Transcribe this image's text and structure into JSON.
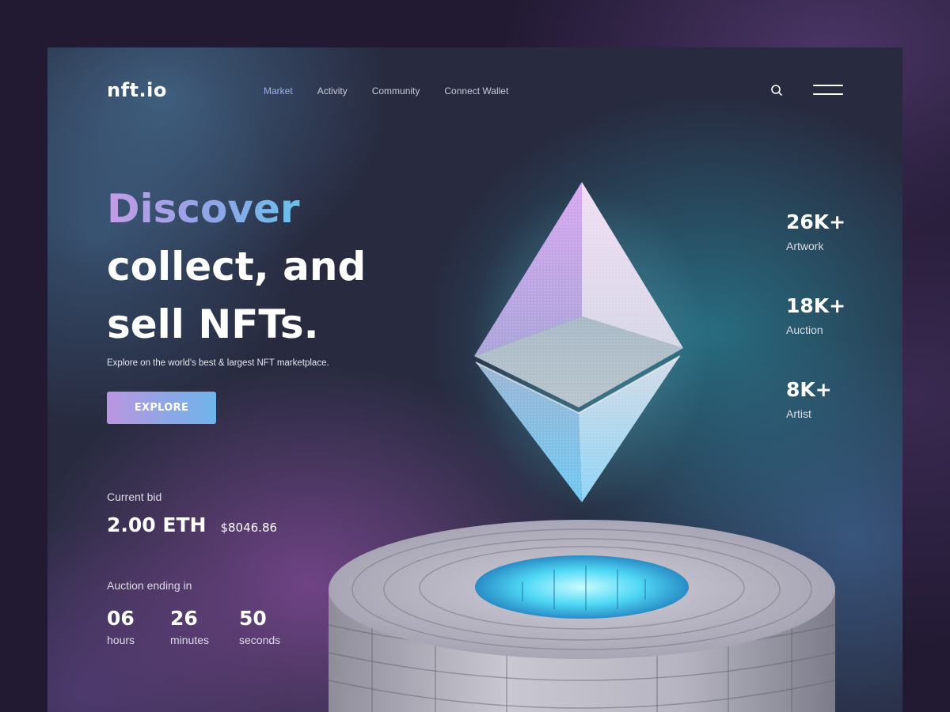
{
  "header": {
    "logo": "nft.io",
    "nav": [
      {
        "label": "Market",
        "active": true
      },
      {
        "label": "Activity",
        "active": false
      },
      {
        "label": "Community",
        "active": false
      },
      {
        "label": "Connect Wallet",
        "active": false
      }
    ],
    "icons": [
      "search-icon",
      "menu-icon"
    ]
  },
  "hero": {
    "title_highlight": "Discover",
    "title_line2": "collect, and",
    "title_line3": "sell NFTs.",
    "subtitle": "Explore on the world's best & largest NFT marketplace.",
    "cta_label": "EXPLORE"
  },
  "bid": {
    "label": "Current bid",
    "eth": "2.00 ETH",
    "usd": "$8046.86"
  },
  "auction": {
    "label": "Auction ending in",
    "countdown": [
      {
        "value": "06",
        "unit": "hours"
      },
      {
        "value": "26",
        "unit": "minutes"
      },
      {
        "value": "50",
        "unit": "seconds"
      }
    ]
  },
  "stats": [
    {
      "value": "26K+",
      "label": "Artwork"
    },
    {
      "value": "18K+",
      "label": "Auction"
    },
    {
      "value": "8K+",
      "label": "Artist"
    }
  ],
  "colors": {
    "page_bg": "#221a33",
    "frame_bg": "#282b40",
    "accent_purple": "#c39ce6",
    "accent_blue": "#6bc0ea",
    "nav_active": "#9cb2f0",
    "text_primary": "#ffffff"
  }
}
